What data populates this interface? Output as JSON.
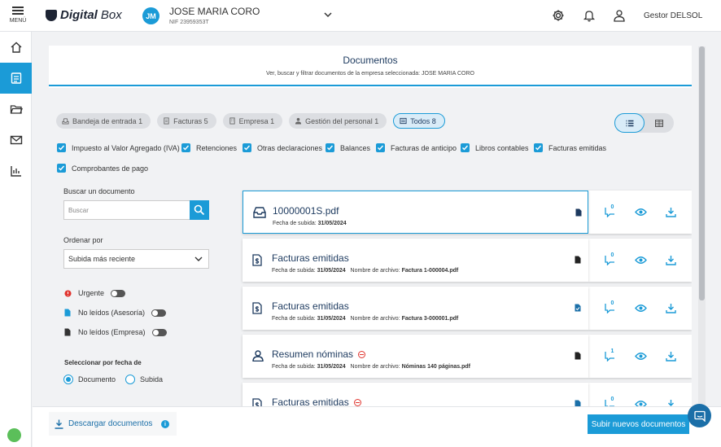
{
  "header": {
    "menu_label": "MENÚ",
    "logo_text_bold": "Digital",
    "logo_text_light": "Box",
    "avatar_initials": "JM",
    "company_name": "JOSE MARIA CORO",
    "company_nif": "NIF 23959353T",
    "user_name": "Gestor DELSOL"
  },
  "sidebar": {
    "items": [
      {
        "icon": "home-icon"
      },
      {
        "icon": "documents-icon",
        "active": true
      },
      {
        "icon": "folder-icon"
      },
      {
        "icon": "mail-icon"
      },
      {
        "icon": "chart-icon"
      }
    ]
  },
  "panel": {
    "title": "Documentos",
    "subtitle": "Ver, buscar y filtrar documentos de la empresa seleccionada: JOSE MARIA CORO"
  },
  "filters": {
    "chips": [
      {
        "label": "Bandeja de entrada 1",
        "icon": "inbox-icon"
      },
      {
        "label": "Facturas 5",
        "icon": "invoice-icon"
      },
      {
        "label": "Empresa 1",
        "icon": "company-icon"
      },
      {
        "label": "Gestión del personal 1",
        "icon": "person-icon"
      },
      {
        "label": "Todos 8",
        "icon": "all-icon",
        "active": true
      }
    ],
    "checkboxes": [
      "Impuesto al Valor Agregado (IVA)",
      "Retenciones",
      "Otras declaraciones",
      "Balances",
      "Facturas de anticipo",
      "Libros contables",
      "Facturas emitidas",
      "Comprobantes de pago"
    ]
  },
  "search": {
    "label": "Buscar un documento",
    "placeholder": "Buscar"
  },
  "sort": {
    "label": "Ordenar por",
    "value": "Subida más reciente"
  },
  "toggles": {
    "urgent": "Urgente",
    "unread_advisory": "No leídos (Asesoría)",
    "unread_company": "No leídos (Empresa)"
  },
  "date_select": {
    "label": "Seleccionar por fecha de",
    "option_document": "Documento",
    "option_upload": "Subida"
  },
  "documents": [
    {
      "title": "10000001S.pdf",
      "date_label": "Fecha de subida:",
      "date": "31/05/2024",
      "file_label": "",
      "file": "",
      "comments": "0",
      "icon": "inbox-icon",
      "urgent": false
    },
    {
      "title": "Facturas emitidas",
      "date_label": "Fecha de subida:",
      "date": "31/05/2024",
      "file_label": "Nombre de archivo:",
      "file": "Factura 1-000004.pdf",
      "comments": "0",
      "icon": "invoice-icon",
      "urgent": false
    },
    {
      "title": "Facturas emitidas",
      "date_label": "Fecha de subida:",
      "date": "31/05/2024",
      "file_label": "Nombre de archivo:",
      "file": "Factura 3-000001.pdf",
      "comments": "0",
      "icon": "invoice-icon",
      "urgent": false
    },
    {
      "title": "Resumen nóminas",
      "date_label": "Fecha de subida:",
      "date": "31/05/2024",
      "file_label": "Nombre de archivo:",
      "file": "Nóminas 140 páginas.pdf",
      "comments": "1",
      "icon": "person-icon",
      "urgent": true
    },
    {
      "title": "Facturas emitidas",
      "date_label": "",
      "date": "",
      "file_label": "",
      "file": "",
      "comments": "0",
      "icon": "invoice-icon",
      "urgent": true
    }
  ],
  "footer": {
    "download_label": "Descargar documentos",
    "upload_label": "Subir nuevos documentos"
  },
  "colors": {
    "accent": "#1b9bd7",
    "navy": "#1d3a5f",
    "danger": "#e0342e"
  }
}
